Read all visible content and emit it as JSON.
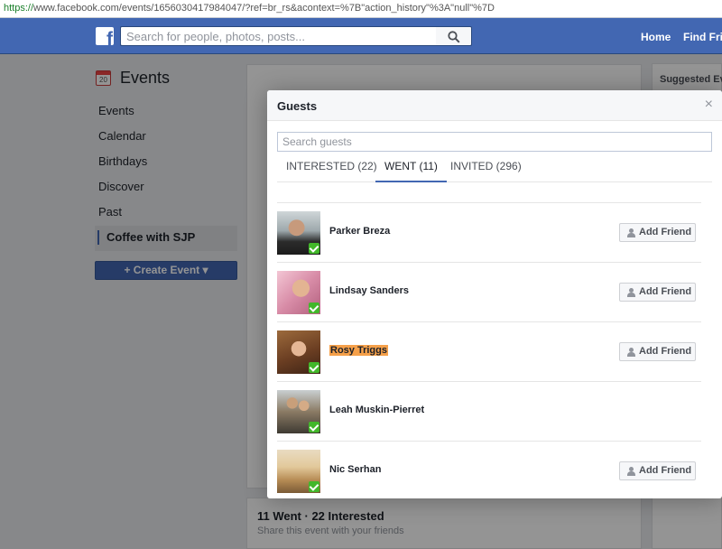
{
  "browser": {
    "url_scheme": "https://",
    "url_rest": "www.facebook.com/events/1656030417984047/?ref=br_rs&acontext=%7B\"action_history\"%3A\"null\"%7D"
  },
  "topbar": {
    "logo_letter": "f",
    "search_placeholder": "Search for people, photos, posts...",
    "home_label": "Home",
    "find_friends_label": "Find Frie"
  },
  "sidebar": {
    "title": "Events",
    "calendar_day": "20",
    "items": [
      {
        "label": "Events"
      },
      {
        "label": "Calendar"
      },
      {
        "label": "Birthdays"
      },
      {
        "label": "Discover"
      },
      {
        "label": "Past"
      },
      {
        "label": "Coffee with SJP"
      }
    ],
    "create_label": "+ Create Event ▾"
  },
  "stats": {
    "title": "11 Went · 22 Interested",
    "subtitle": "Share this event with your friends"
  },
  "right": {
    "title": "Suggested Ev"
  },
  "modal": {
    "title": "Guests",
    "close": "×",
    "search_placeholder": "Search guests",
    "tabs": [
      {
        "label": "INTERESTED (22)"
      },
      {
        "label": "WENT (11)"
      },
      {
        "label": "INVITED (296)"
      }
    ],
    "add_friend_label": "Add Friend",
    "guests": [
      {
        "name": "Parker Breza",
        "went": true
      },
      {
        "name": "Lindsay Sanders",
        "went": true
      },
      {
        "name": "Rosy Triggs",
        "went": true,
        "highlight": "#f5a04a"
      },
      {
        "name": "Leah Muskin-Pierret",
        "went": true
      },
      {
        "name": "Nic Serhan",
        "went": true
      }
    ]
  },
  "colors": {
    "brand": "#4267b2",
    "went_check": "#42b72a",
    "highlight": "#f5a04a"
  }
}
